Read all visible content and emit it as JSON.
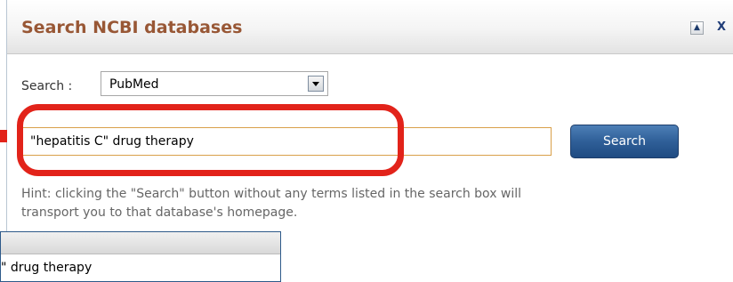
{
  "dialog": {
    "title": "Search NCBI databases",
    "collapse_icon": "triangle-up-icon",
    "close_label": "X"
  },
  "search": {
    "label": "Search :",
    "database": "PubMed",
    "query": "\"hepatitis C\" drug therapy",
    "button_label": "Search"
  },
  "hint": {
    "line1": "Hint: clicking the \"Search\" button without any terms listed in the search box will",
    "line2": "transport you to that database's homepage."
  },
  "suggestions": {
    "item": "\" drug therapy"
  },
  "colors": {
    "title": "#985735",
    "highlight": "#e2231a",
    "button": "#2f5f98"
  }
}
